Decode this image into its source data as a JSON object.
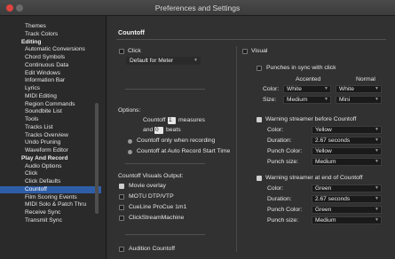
{
  "window": {
    "title": "Preferences and Settings"
  },
  "sidebar": {
    "items": [
      {
        "label": "Themes",
        "kind": "child"
      },
      {
        "label": "Track Colors",
        "kind": "child"
      },
      {
        "label": "Editing",
        "kind": "header"
      },
      {
        "label": "Automatic Conversions",
        "kind": "child"
      },
      {
        "label": "Chord Symbols",
        "kind": "child"
      },
      {
        "label": "Continuous Data",
        "kind": "child"
      },
      {
        "label": "Edit Windows",
        "kind": "child"
      },
      {
        "label": "Information Bar",
        "kind": "child"
      },
      {
        "label": "Lyrics",
        "kind": "child"
      },
      {
        "label": "MIDI Editing",
        "kind": "child"
      },
      {
        "label": "Region Commands",
        "kind": "child"
      },
      {
        "label": "Soundbite List",
        "kind": "child"
      },
      {
        "label": "Tools",
        "kind": "child"
      },
      {
        "label": "Tracks List",
        "kind": "child"
      },
      {
        "label": "Tracks Overview",
        "kind": "child"
      },
      {
        "label": "Undo Pruning",
        "kind": "child"
      },
      {
        "label": "Waveform Editor",
        "kind": "child"
      },
      {
        "label": "Play And Record",
        "kind": "header"
      },
      {
        "label": "Audio Options",
        "kind": "child"
      },
      {
        "label": "Click",
        "kind": "child"
      },
      {
        "label": "Click Defaults",
        "kind": "child"
      },
      {
        "label": "Countoff",
        "kind": "child",
        "selected": true
      },
      {
        "label": "Film Scoring Events",
        "kind": "child"
      },
      {
        "label": "MIDI Solo & Patch Thru",
        "kind": "child"
      },
      {
        "label": "Receive Sync",
        "kind": "child"
      },
      {
        "label": "Transmit Sync",
        "kind": "child"
      }
    ]
  },
  "main": {
    "section_title": "Countoff",
    "click": {
      "label": "Click",
      "checked": false,
      "dropdown": "Default for Meter"
    },
    "options": {
      "title": "Options:",
      "countoff_label": "Countoff",
      "measures_value": "1",
      "measures_label": "measures",
      "and_label": "and",
      "beats_value": "0",
      "beats_label": "beats",
      "radio_only_recording": "Countoff only when recording",
      "radio_auto_record": "Countoff at Auto Record Start Time",
      "selected": "only_recording"
    },
    "visuals_output": {
      "title": "Countoff Visuals Output:",
      "items": [
        {
          "label": "Movie overlay",
          "checked": true
        },
        {
          "label": "MOTU DTP/VTP",
          "checked": false
        },
        {
          "label": "CueLine ProCue 1m1",
          "checked": false
        },
        {
          "label": "ClickStreamMachine",
          "checked": false
        }
      ]
    },
    "audition_countoff": {
      "label": "Audition Countoff",
      "checked": false
    },
    "visual": {
      "label": "Visual",
      "checked": false,
      "punches": {
        "label": "Punches in sync with click",
        "checked": false
      },
      "accented_header": "Accented",
      "normal_header": "Normal",
      "color_label": "Color:",
      "color_accented": "White",
      "color_normal": "White",
      "size_label": "Size:",
      "size_accented": "Medium",
      "size_normal": "Mini"
    },
    "warning_before": {
      "label": "Warning streamer before Countoff",
      "checked": true,
      "color_label": "Color:",
      "color": "Yellow",
      "duration_label": "Duration:",
      "duration": "2.67 seconds",
      "punch_color_label": "Punch Color:",
      "punch_color": "Yellow",
      "punch_size_label": "Punch size:",
      "punch_size": "Medium"
    },
    "warning_end": {
      "label": "Warning streamer at end of Countoff",
      "checked": true,
      "color_label": "Color:",
      "color": "Green",
      "duration_label": "Duration:",
      "duration": "2.67 seconds",
      "punch_color_label": "Punch Color:",
      "punch_color": "Green",
      "punch_size_label": "Punch size:",
      "punch_size": "Medium"
    }
  },
  "colors": {
    "selection": "#2f5ea8",
    "window_bg": "#313131",
    "close_button": "#e0443e"
  }
}
